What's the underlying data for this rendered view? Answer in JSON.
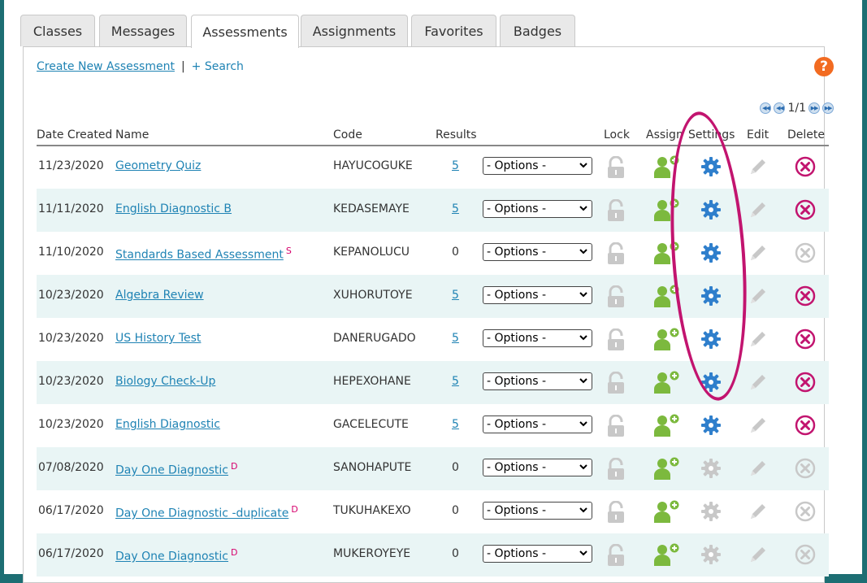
{
  "tabs": [
    {
      "label": "Classes",
      "active": false
    },
    {
      "label": "Messages",
      "active": false
    },
    {
      "label": "Assessments",
      "active": true
    },
    {
      "label": "Assignments",
      "active": false
    },
    {
      "label": "Favorites",
      "active": false
    },
    {
      "label": "Badges",
      "active": false
    }
  ],
  "toolbar": {
    "create_label": "Create New Assessment",
    "separator": "|",
    "search_label": "+ Search",
    "help_label": "?"
  },
  "pager": {
    "page_text": "1/1"
  },
  "columns": {
    "date": "Date Created",
    "name": "Name",
    "code": "Code",
    "results": "Results",
    "lock": "Lock",
    "assign": "Assign",
    "settings": "Settings",
    "edit": "Edit",
    "delete": "Delete"
  },
  "options_label": "- Options -",
  "colors": {
    "link": "#1f83b4",
    "assign_green": "#7cb93e",
    "settings_blue": "#2f7fcc",
    "delete_magenta": "#c2146f",
    "disabled_gray": "#c8c8c8",
    "row_alt": "#e9f5f5",
    "help_orange": "#f26b21"
  },
  "rows": [
    {
      "date": "11/23/2020",
      "name": "Geometry Quiz",
      "suffix": "",
      "code": "HAYUCOGUKE",
      "results": "5",
      "results_link": true,
      "settings_enabled": true,
      "delete_enabled": true
    },
    {
      "date": "11/11/2020",
      "name": "English Diagnostic B",
      "suffix": "",
      "code": "KEDASEMAYE",
      "results": "5",
      "results_link": true,
      "settings_enabled": true,
      "delete_enabled": true
    },
    {
      "date": "11/10/2020",
      "name": "Standards Based Assessment",
      "suffix": "S",
      "code": "KEPANOLUCU",
      "results": "0",
      "results_link": false,
      "settings_enabled": true,
      "delete_enabled": false
    },
    {
      "date": "10/23/2020",
      "name": "Algebra Review",
      "suffix": "",
      "code": "XUHORUTOYE",
      "results": "5",
      "results_link": true,
      "settings_enabled": true,
      "delete_enabled": true
    },
    {
      "date": "10/23/2020",
      "name": "US History Test",
      "suffix": "",
      "code": "DANERUGADO",
      "results": "5",
      "results_link": true,
      "settings_enabled": true,
      "delete_enabled": true
    },
    {
      "date": "10/23/2020",
      "name": "Biology Check-Up",
      "suffix": "",
      "code": "HEPEXOHANE",
      "results": "5",
      "results_link": true,
      "settings_enabled": true,
      "delete_enabled": true
    },
    {
      "date": "10/23/2020",
      "name": "English Diagnostic",
      "suffix": "",
      "code": "GACELECUTE",
      "results": "5",
      "results_link": true,
      "settings_enabled": true,
      "delete_enabled": true
    },
    {
      "date": "07/08/2020",
      "name": "Day One Diagnostic",
      "suffix": "D",
      "code": "SANOHAPUTE",
      "results": "0",
      "results_link": false,
      "settings_enabled": false,
      "delete_enabled": false
    },
    {
      "date": "06/17/2020",
      "name": "Day One Diagnostic -duplicate",
      "suffix": "D",
      "code": "TUKUHAKEXO",
      "results": "0",
      "results_link": false,
      "settings_enabled": false,
      "delete_enabled": false
    },
    {
      "date": "06/17/2020",
      "name": "Day One Diagnostic",
      "suffix": "D",
      "code": "MUKEROYEYE",
      "results": "0",
      "results_link": false,
      "settings_enabled": false,
      "delete_enabled": false
    }
  ]
}
